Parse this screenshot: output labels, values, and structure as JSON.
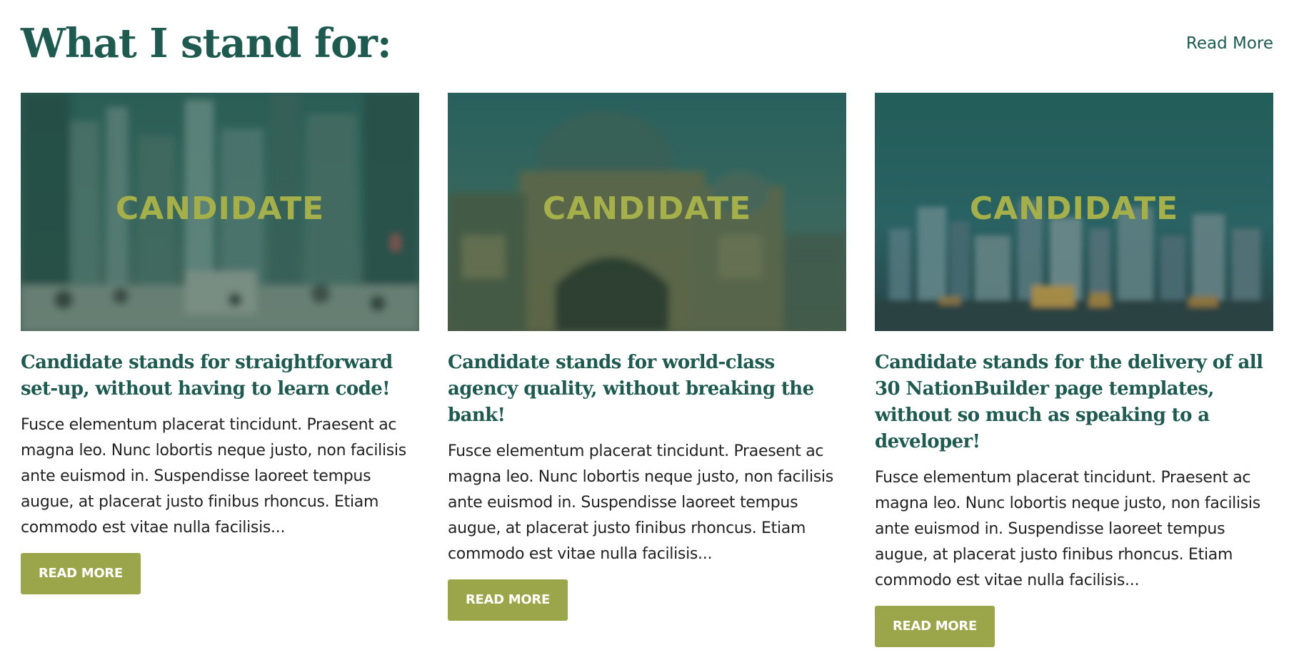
{
  "header": {
    "title": "What I stand for:",
    "read_more_link": "Read More"
  },
  "colors": {
    "heading": "#1f5a50",
    "accent": "#9ba64a",
    "logo": "#a5b04a",
    "body_text": "#222222"
  },
  "cards": [
    {
      "image_icon": "city-street-photo",
      "logo_text": "CANDIDATE",
      "title": "Candidate stands for straightforward set-up, without having to learn code!",
      "body": "Fusce elementum placerat tincidunt. Praesent ac magna leo. Nunc lobortis neque justo, non facilisis ante euismod in. Suspendisse laoreet tempus augue, at placerat justo finibus rhoncus. Etiam commodo est vitae nulla facilisis...",
      "button": "READ MORE"
    },
    {
      "image_icon": "station-building-photo",
      "logo_text": "CANDIDATE",
      "title": "Candidate stands for world-class agency quality, without breaking the bank!",
      "body": "Fusce elementum placerat tincidunt. Praesent ac magna leo. Nunc lobortis neque justo, non facilisis ante euismod in. Suspendisse laoreet tempus augue, at placerat justo finibus rhoncus. Etiam commodo est vitae nulla facilisis...",
      "button": "READ MORE"
    },
    {
      "image_icon": "city-skyline-photo",
      "logo_text": "CANDIDATE",
      "title": "Candidate stands for the delivery of all 30 NationBuilder page templates, without so much as speaking to a developer!",
      "body": "Fusce elementum placerat tincidunt. Praesent ac magna leo. Nunc lobortis neque justo, non facilisis ante euismod in. Suspendisse laoreet tempus augue, at placerat justo finibus rhoncus. Etiam commodo est vitae nulla facilisis...",
      "button": "READ MORE"
    }
  ]
}
